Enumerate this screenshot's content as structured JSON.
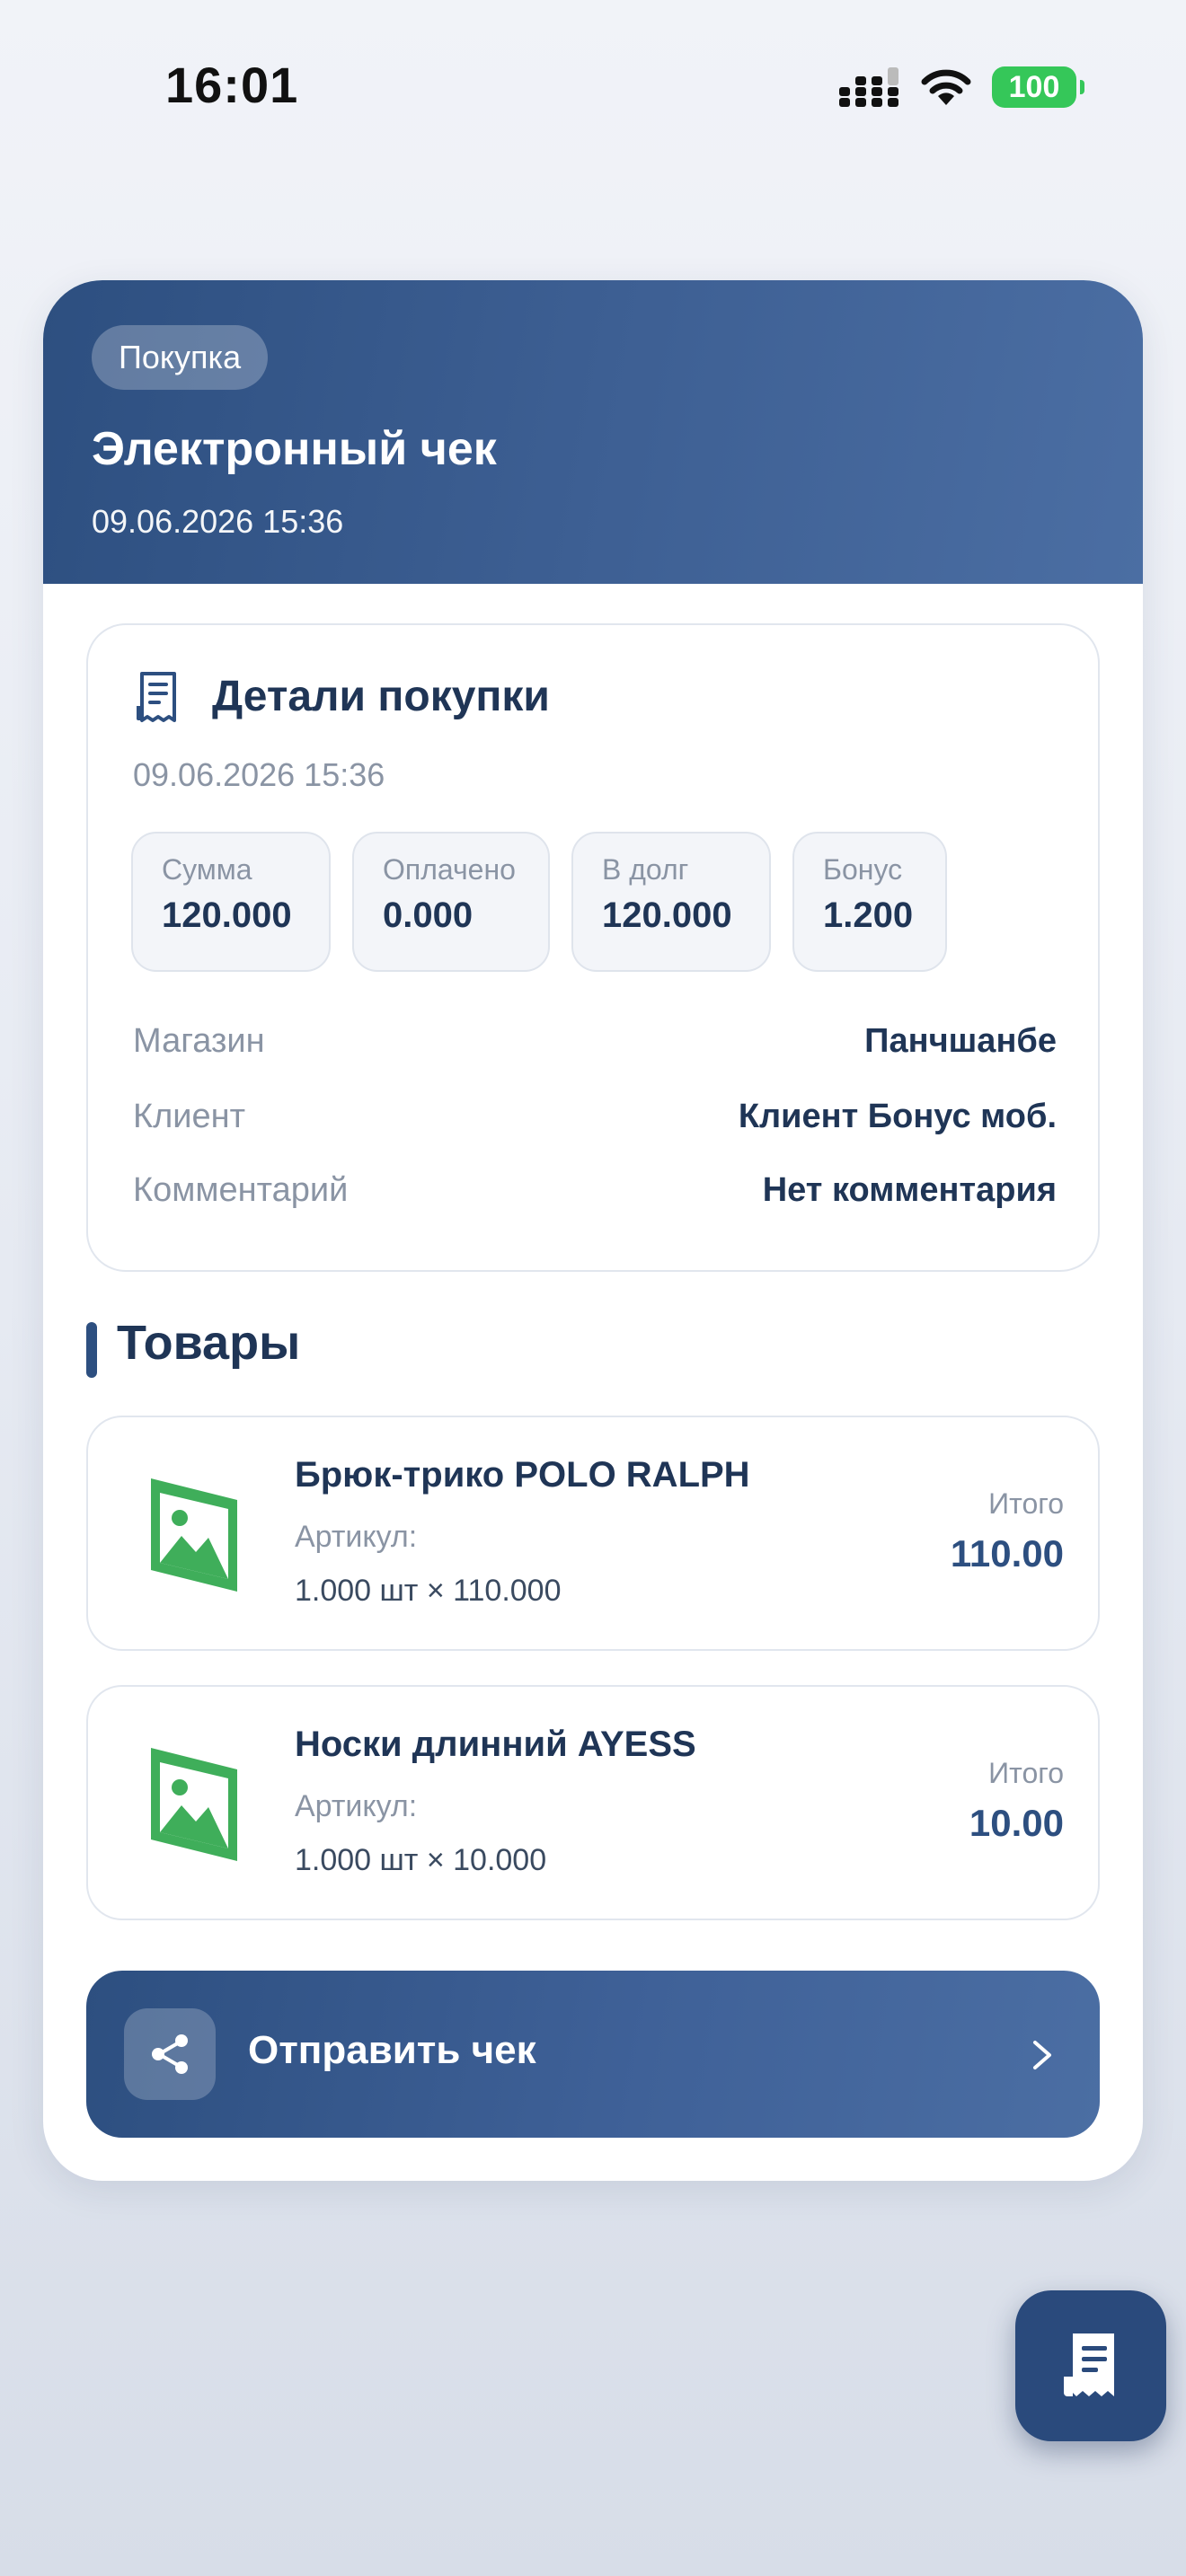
{
  "status_bar": {
    "time": "16:01",
    "battery": "100",
    "icons": [
      "signal-icon",
      "wifi-icon",
      "battery-icon"
    ]
  },
  "header": {
    "badge": "Покупка",
    "title": "Электронный чек",
    "date": "09.06.2026 15:36"
  },
  "details": {
    "title": "Детали покупки",
    "date": "09.06.2026 15:36",
    "stats": [
      {
        "label": "Сумма",
        "value": "120.000"
      },
      {
        "label": "Оплачено",
        "value": "0.000"
      },
      {
        "label": "В долг",
        "value": "120.000"
      },
      {
        "label": "Бонус",
        "value": "1.200"
      }
    ],
    "rows": [
      {
        "label": "Магазин",
        "value": "Панчшанбе"
      },
      {
        "label": "Клиент",
        "value": "Клиент Бонус моб."
      },
      {
        "label": "Комментарий",
        "value": "Нет комментария"
      }
    ]
  },
  "products": {
    "title": "Товары",
    "items": [
      {
        "name": "Брюк-трико POLO RALPH",
        "sku": "Артикул:",
        "qty": "1.000 шт × 110.000",
        "total_label": "Итого",
        "total": "110.00"
      },
      {
        "name": "Носки длинний AYESS",
        "sku": "Артикул:",
        "qty": "1.000 шт × 10.000",
        "total_label": "Итого",
        "total": "10.00"
      }
    ]
  },
  "send_button": {
    "label": "Отправить чек",
    "icon": "share-icon"
  },
  "fab": {
    "icon": "receipt-icon"
  },
  "colors": {
    "primary": "#2d4f80",
    "text": "#1f3556",
    "muted": "#8a94a4",
    "battery": "#35c759",
    "image_placeholder": "#3fae5a"
  }
}
